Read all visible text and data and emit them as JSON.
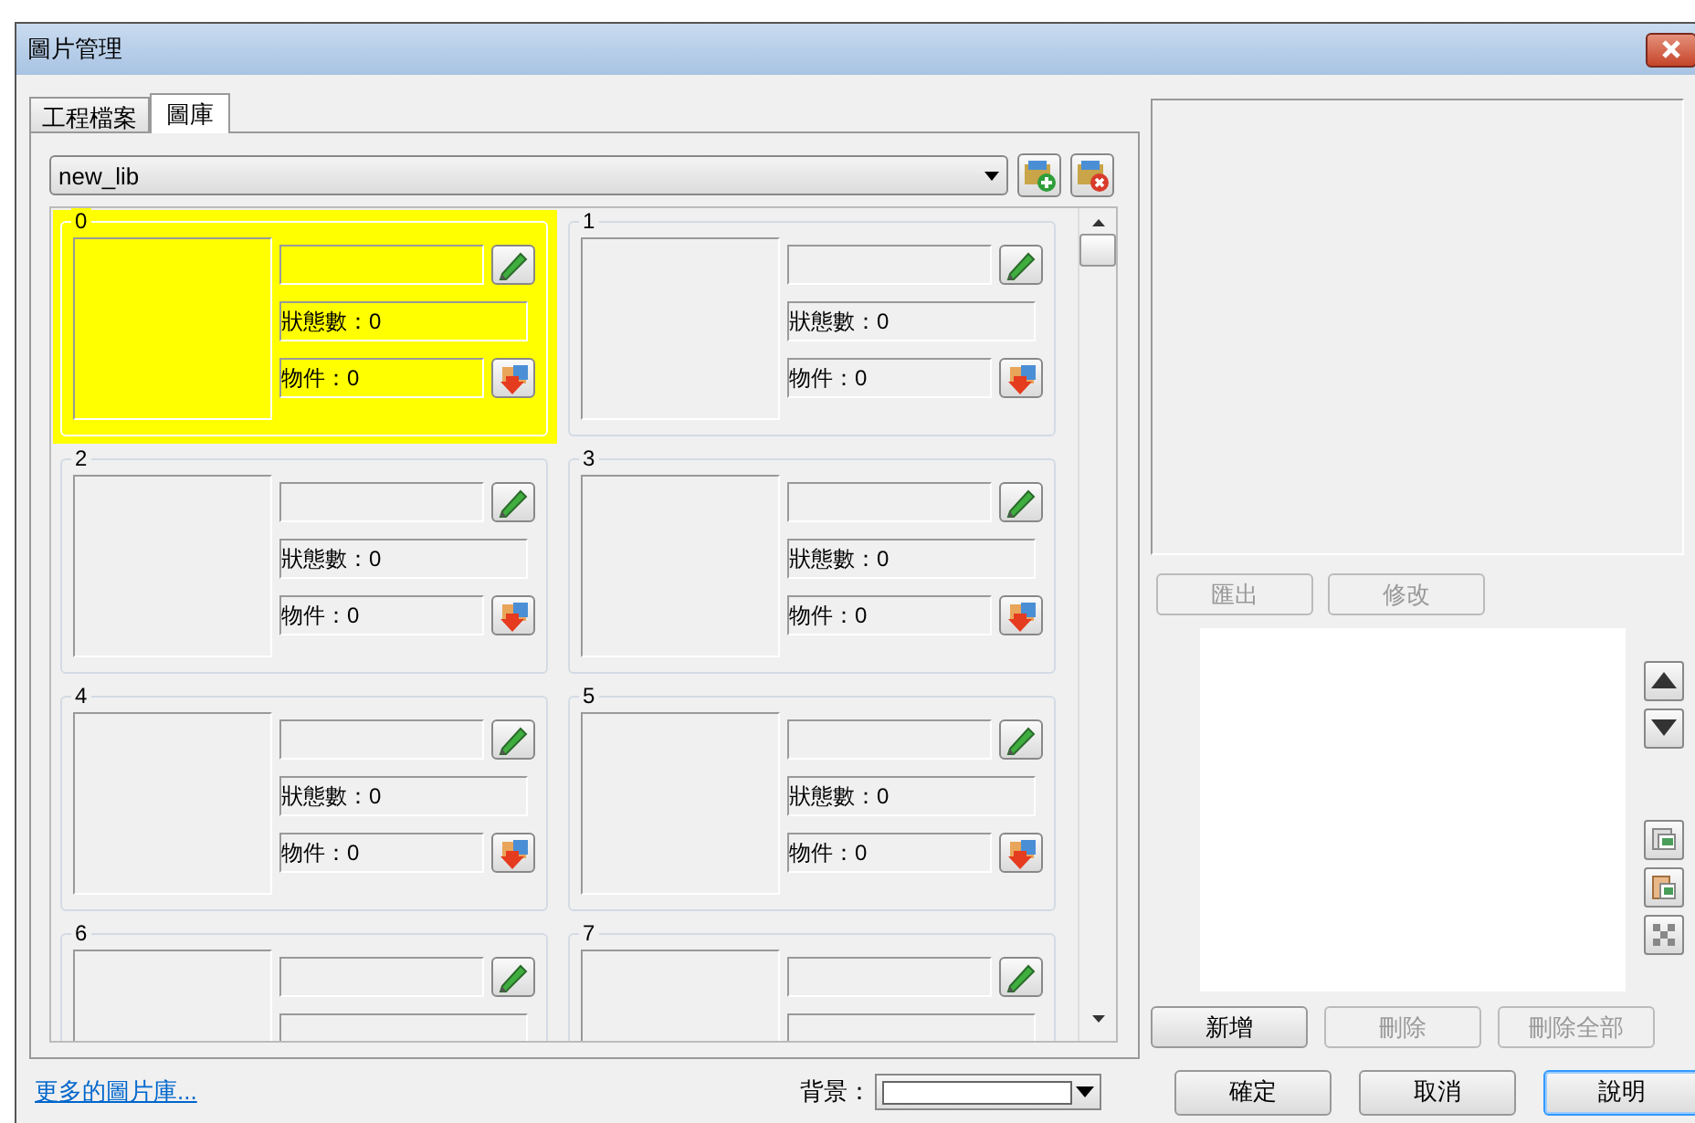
{
  "window": {
    "title": "圖片管理"
  },
  "tabs": [
    {
      "label": "工程檔案",
      "selected": false
    },
    {
      "label": "圖庫",
      "selected": true
    }
  ],
  "library_select": {
    "value": "new_lib"
  },
  "tiles": [
    {
      "number": "0",
      "selected": true,
      "states": "狀態數：0",
      "objects": "物件：0"
    },
    {
      "number": "1",
      "selected": false,
      "states": "狀態數：0",
      "objects": "物件：0"
    },
    {
      "number": "2",
      "selected": false,
      "states": "狀態數：0",
      "objects": "物件：0"
    },
    {
      "number": "3",
      "selected": false,
      "states": "狀態數：0",
      "objects": "物件：0"
    },
    {
      "number": "4",
      "selected": false,
      "states": "狀態數：0",
      "objects": "物件：0"
    },
    {
      "number": "5",
      "selected": false,
      "states": "狀態數：0",
      "objects": "物件：0"
    },
    {
      "number": "6",
      "selected": false
    },
    {
      "number": "7",
      "selected": false
    }
  ],
  "image_buttons": [
    {
      "label": "匯出",
      "disabled": true
    },
    {
      "label": "修改",
      "disabled": true
    }
  ],
  "list_buttons": [
    {
      "label": "新增",
      "disabled": false
    },
    {
      "label": "刪除",
      "disabled": true
    },
    {
      "label": "刪除全部",
      "disabled": true
    }
  ],
  "more_link": "更多的圖片庫...",
  "background": {
    "label": "背景："
  },
  "dialog_buttons": [
    {
      "label": "確定",
      "default": false
    },
    {
      "label": "取消",
      "default": false
    },
    {
      "label": "說明",
      "default": true
    }
  ]
}
